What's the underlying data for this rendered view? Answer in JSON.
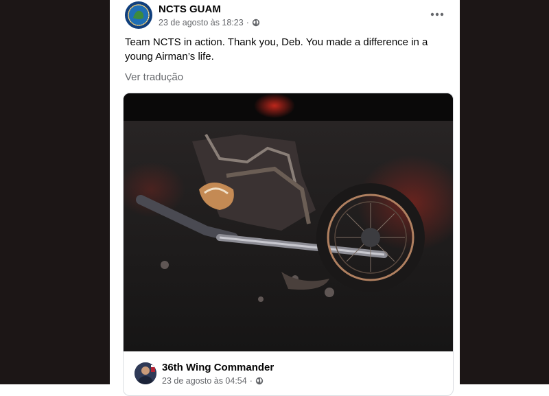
{
  "post": {
    "author": "NCTS GUAM",
    "timestamp": "23 de agosto às 18:23",
    "separator": "·",
    "privacy_icon": "globe-icon",
    "more_icon": "more-options-icon",
    "text": "Team NCTS in action. Thank you, Deb. You made a difference in a young Airman’s life.",
    "translate_link": "Ver tradução"
  },
  "shared_post": {
    "author": "36th Wing Commander",
    "timestamp": "23 de agosto às 04:54",
    "separator": "·",
    "privacy_icon": "globe-icon"
  },
  "colors": {
    "backdrop": "#1c1616",
    "card": "#ffffff",
    "primary_text": "#050505",
    "secondary_text": "#65676b",
    "border": "#dadde1"
  }
}
